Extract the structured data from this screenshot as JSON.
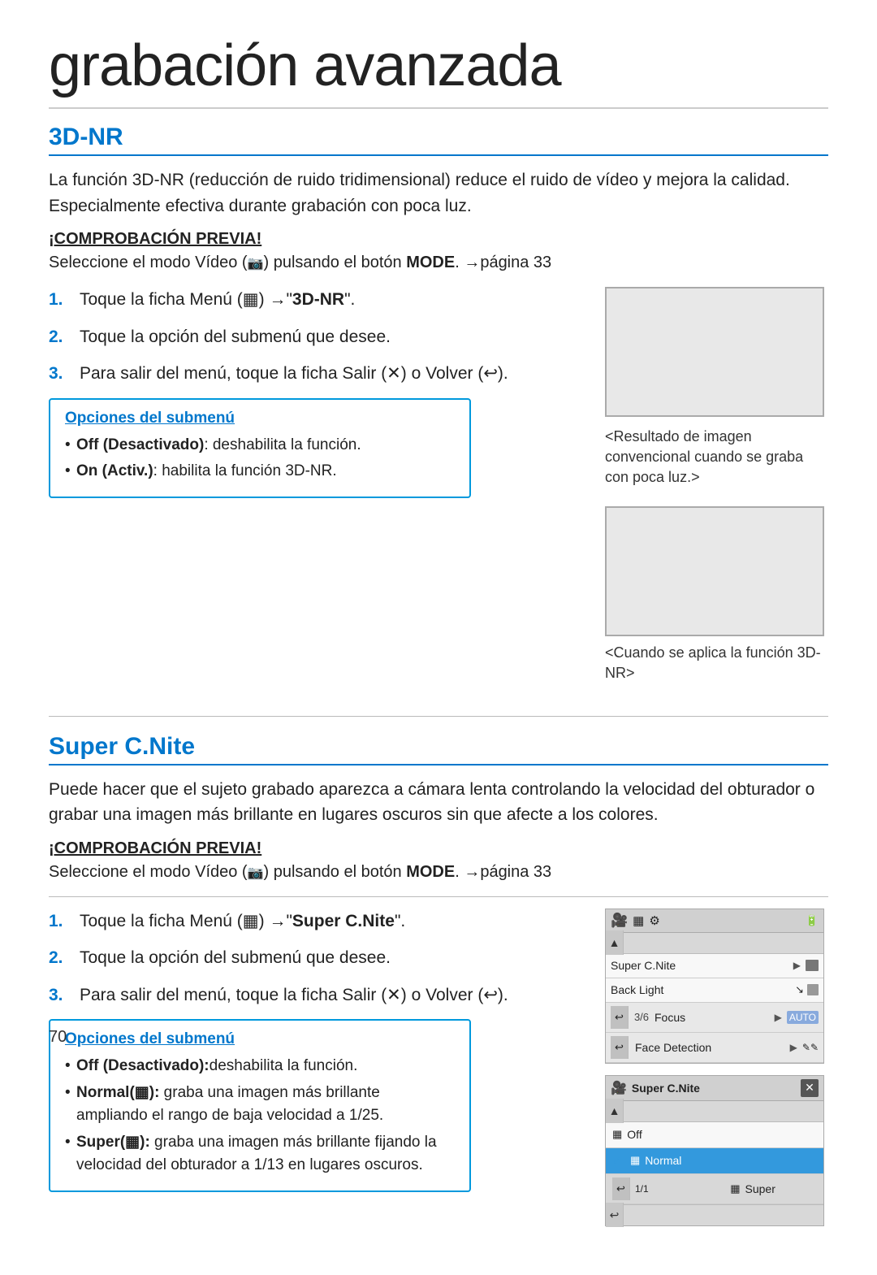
{
  "page": {
    "title": "grabación avanzada",
    "page_number": "70"
  },
  "section_3d": {
    "title": "3D-NR",
    "desc": "La función 3D-NR (reducción de ruido tridimensional) reduce el ruido de vídeo y mejora la calidad. Especialmente efectiva durante grabación con poca luz.",
    "check_label": "¡COMPROBACIÓN PREVIA!",
    "check_desc": "Seleccione el modo Vídeo (📷) pulsando el botón MODE. →página 33",
    "steps": [
      {
        "num": "1.",
        "text": "Toque la ficha Menú (",
        "bold": "3D-NR",
        "suffix": "\".",
        "prefix": "\"",
        "full": "Toque la ficha Menú (▦) →\"3D-NR\"."
      },
      {
        "num": "2.",
        "text": "Toque la opción del submenú que desee.",
        "full": "Toque la opción del submenú que desee."
      },
      {
        "num": "3.",
        "text": "Para salir del menú, toque la ficha Salir (✕) o Volver (↩).",
        "full": "Para salir del menú, toque la ficha Salir (✕) o Volver (↩)."
      }
    ],
    "image_caption_top": "<Resultado de imagen convencional cuando se graba con poca luz.>",
    "image_caption_bottom": "<Cuando se aplica la función 3D-NR>",
    "submenu_title": "Opciones del submenú",
    "submenu_items": [
      {
        "label": "Off (Desactivado)",
        "desc": ": deshabilita la función."
      },
      {
        "label": "On (Activ.)",
        "desc": ": habilita la función 3D-NR."
      }
    ]
  },
  "section_super": {
    "title": "Super C.Nite",
    "desc": "Puede hacer que el sujeto grabado aparezca a cámara lenta controlando la velocidad del obturador o grabar una imagen más brillante en lugares oscuros sin que afecte a los colores.",
    "check_label": "¡COMPROBACIÓN PREVIA!",
    "check_desc": "Seleccione el modo Vídeo (📷) pulsando el botón MODE. →página 33",
    "steps": [
      {
        "num": "1.",
        "full": "Toque la ficha Menú (▦) →\"Super C.Nite\"."
      },
      {
        "num": "2.",
        "full": "Toque la opción del submenú que desee."
      },
      {
        "num": "3.",
        "full": "Para salir del menú, toque la ficha Salir (✕) o Volver (↩)."
      }
    ],
    "submenu_title": "Opciones del submenú",
    "submenu_items": [
      {
        "label": "Off (Desactivado):",
        "desc": "deshabilita la función."
      },
      {
        "label": "Normal(▦):",
        "desc": "graba una imagen más brillante ampliando el rango de baja velocidad a 1/25."
      },
      {
        "label": "Super(▦):",
        "desc": "graba una imagen más brillante fijando la velocidad del obturador a 1/13 en lugares oscuros."
      }
    ],
    "camera_menu": {
      "rows": [
        {
          "label": "Super C.Nite",
          "val": "▶ ▦",
          "highlighted": false
        },
        {
          "label": "Back Light",
          "val": "↘ ✎",
          "highlighted": false
        },
        {
          "label": "Focus",
          "val": "▶ AUTO",
          "highlighted": false
        },
        {
          "label": "Face Detection",
          "val": "▶ ✎✎",
          "highlighted": false
        }
      ],
      "page": "3/6",
      "popup": {
        "title": "Super C.Nite",
        "rows": [
          {
            "label": "▦ Off",
            "highlighted": false
          },
          {
            "label": "Normal",
            "highlighted": true,
            "checked": true
          },
          {
            "label": "▦ Super",
            "highlighted": false
          }
        ],
        "page": "1/1"
      }
    }
  }
}
